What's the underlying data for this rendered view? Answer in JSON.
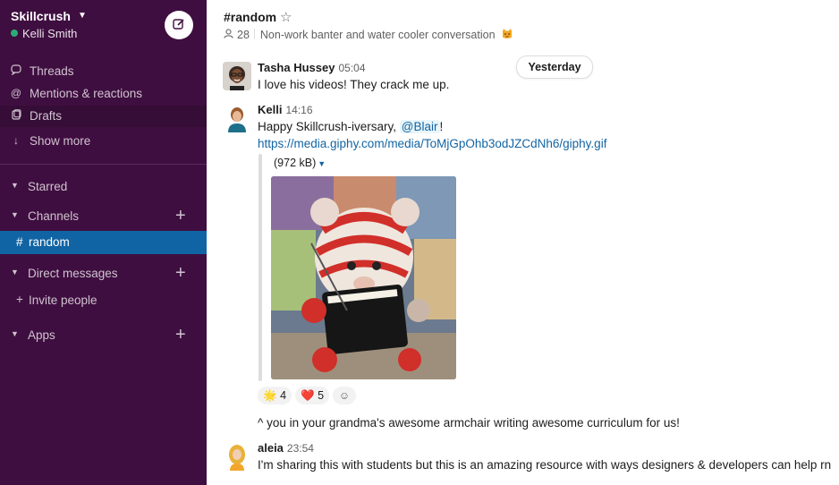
{
  "workspace": {
    "name": "Skillcrush",
    "user": "Kelli Smith"
  },
  "sidebar": {
    "items": [
      {
        "label": "Threads",
        "icon": "threads-icon"
      },
      {
        "label": "Mentions & reactions",
        "icon": "at-icon"
      },
      {
        "label": "Drafts",
        "icon": "drafts-icon"
      },
      {
        "label": "Show more",
        "icon": "arrow-down-icon"
      }
    ],
    "sections": {
      "starred": "Starred",
      "channels": "Channels",
      "direct_messages": "Direct messages",
      "apps": "Apps"
    },
    "active_channel": "random",
    "invite": "Invite people"
  },
  "channel": {
    "title": "#random",
    "member_count": "28",
    "topic": "Non-work banter and water cooler conversation",
    "day_divider": "Yesterday"
  },
  "messages": [
    {
      "author": "Tasha Hussey",
      "time": "05:04",
      "text": "I love his videos! They crack me up."
    },
    {
      "author": "Kelli",
      "time": "14:16",
      "text_before": "Happy Skillcrush-iversary, ",
      "mention": "@Blair",
      "text_after": "!",
      "link": "https://media.giphy.com/media/ToMjGpOhb3odJZCdNh6/giphy.gif",
      "attachment_size": "(972 kB)",
      "reactions": [
        {
          "emoji": "🌟",
          "count": "4"
        },
        {
          "emoji": "❤️",
          "count": "5"
        }
      ],
      "followup": "^ you in your grandma's awesome armchair writing awesome curriculum for us!"
    },
    {
      "author": "aleia",
      "time": "23:54",
      "text": "I'm sharing this with students but this is an amazing resource with ways designers & developers can help rn"
    }
  ],
  "colors": {
    "sidebar_bg": "#3f0e40",
    "active_channel_bg": "#1164a3",
    "link": "#1264a3",
    "presence": "#2bac76"
  }
}
